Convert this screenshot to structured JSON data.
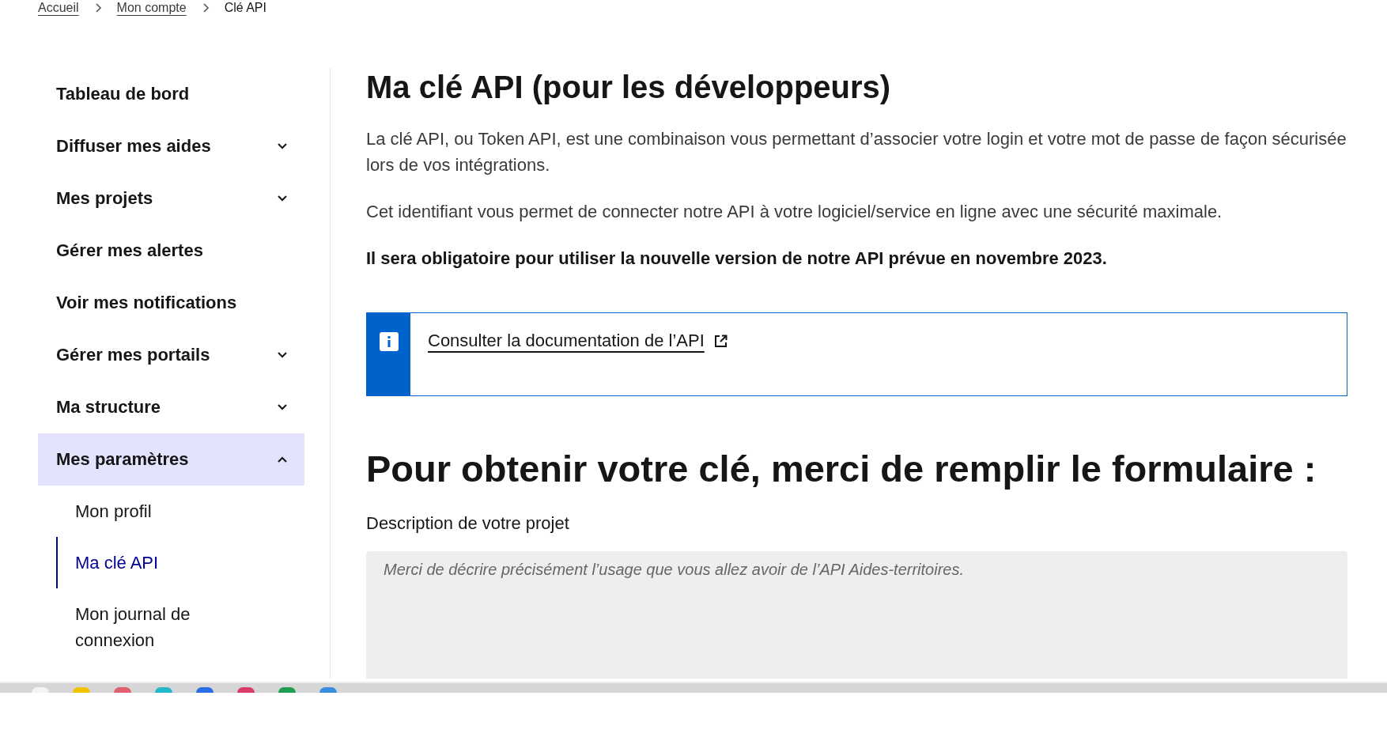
{
  "breadcrumb": [
    {
      "label": "Accueil",
      "kind": "link"
    },
    {
      "label": "Mon compte",
      "kind": "link"
    },
    {
      "label": "Clé API",
      "kind": "current"
    }
  ],
  "sidebar": {
    "items": [
      {
        "label": "Tableau de bord",
        "expandable": false,
        "selected": false
      },
      {
        "label": "Diffuser mes aides",
        "expandable": true,
        "expanded": false,
        "selected": false
      },
      {
        "label": "Mes projets",
        "expandable": true,
        "expanded": false,
        "selected": false
      },
      {
        "label": "Gérer mes alertes",
        "expandable": false,
        "selected": false
      },
      {
        "label": "Voir mes notifications",
        "expandable": false,
        "selected": false
      },
      {
        "label": "Gérer mes portails",
        "expandable": true,
        "expanded": false,
        "selected": false
      },
      {
        "label": "Ma structure",
        "expandable": true,
        "expanded": false,
        "selected": false
      },
      {
        "label": "Mes paramètres",
        "expandable": true,
        "expanded": true,
        "selected": true,
        "children": [
          {
            "label": "Mon profil",
            "selected": false
          },
          {
            "label": "Ma clé API",
            "selected": true
          },
          {
            "label": "Mon journal de connexion",
            "selected": false
          }
        ]
      }
    ]
  },
  "main": {
    "title": "Ma clé API (pour les développeurs)",
    "paragraphs": [
      {
        "text": "La clé API, ou Token API, est une combinaison vous permettant d’associer votre login et votre mot de passe de façon sécurisée lors de vos intégrations.",
        "bold": false
      },
      {
        "text": "Cet identifiant vous permet de connecter notre API à votre logiciel/service en ligne avec une sécurité maximale.",
        "bold": false
      },
      {
        "text": "Il sera obligatoire pour utiliser la nouvelle version de notre API prévue en novembre 2023.",
        "bold": true
      }
    ],
    "callout": {
      "link": "Consulter la documentation de l’API"
    },
    "form_title": "Pour obtenir votre clé, merci de remplir le formulaire :",
    "field": {
      "label": "Description de votre projet",
      "placeholder": "Merci de décrire précisément l’usage que vous allez avoir de l’API Aides-territoires."
    }
  }
}
